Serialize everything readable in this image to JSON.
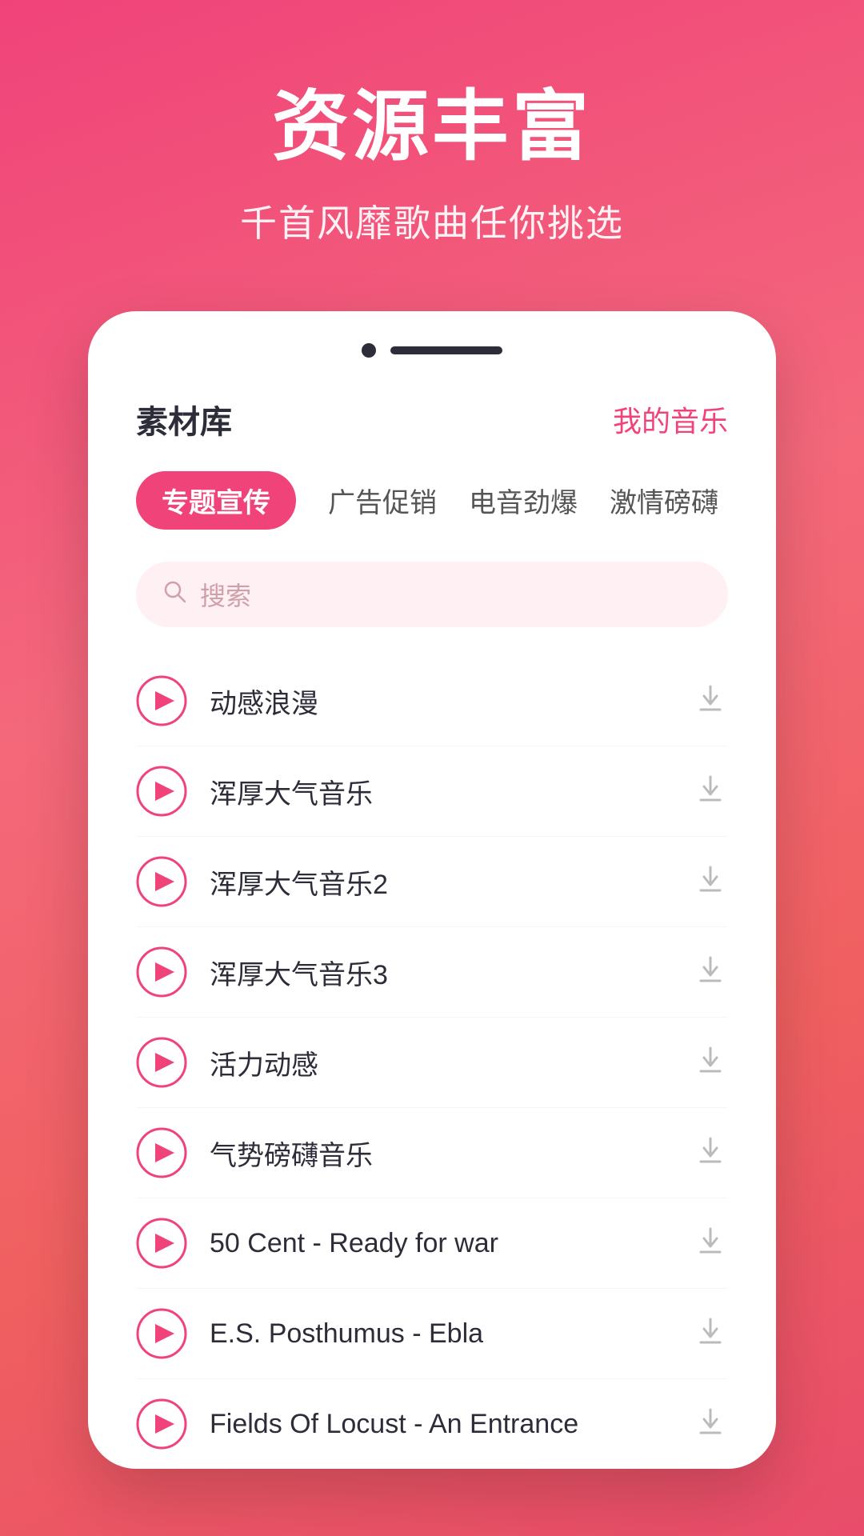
{
  "hero": {
    "title": "资源丰富",
    "subtitle": "千首风靡歌曲任你挑选"
  },
  "app": {
    "section_title": "素材库",
    "my_music_label": "我的音乐",
    "tabs": [
      {
        "id": "tab1",
        "label": "专题宣传",
        "active": true
      },
      {
        "id": "tab2",
        "label": "广告促销",
        "active": false
      },
      {
        "id": "tab3",
        "label": "电音劲爆",
        "active": false
      },
      {
        "id": "tab4",
        "label": "激情磅礴",
        "active": false
      }
    ],
    "search": {
      "placeholder": "搜索"
    },
    "songs": [
      {
        "id": 1,
        "title": "动感浪漫"
      },
      {
        "id": 2,
        "title": "浑厚大气音乐"
      },
      {
        "id": 3,
        "title": "浑厚大气音乐2"
      },
      {
        "id": 4,
        "title": "浑厚大气音乐3"
      },
      {
        "id": 5,
        "title": "活力动感"
      },
      {
        "id": 6,
        "title": "气势磅礴音乐"
      },
      {
        "id": 7,
        "title": "50 Cent - Ready for war"
      },
      {
        "id": 8,
        "title": "E.S. Posthumus - Ebla"
      },
      {
        "id": 9,
        "title": "Fields Of Locust - An Entrance"
      }
    ]
  },
  "colors": {
    "accent": "#f0437a",
    "text_dark": "#2d2d3a",
    "text_light": "#bbb",
    "tab_active_bg": "#f0437a",
    "search_bg": "#fef0f3"
  },
  "icons": {
    "search": "🔍",
    "play": "▶",
    "download": "⬇"
  }
}
